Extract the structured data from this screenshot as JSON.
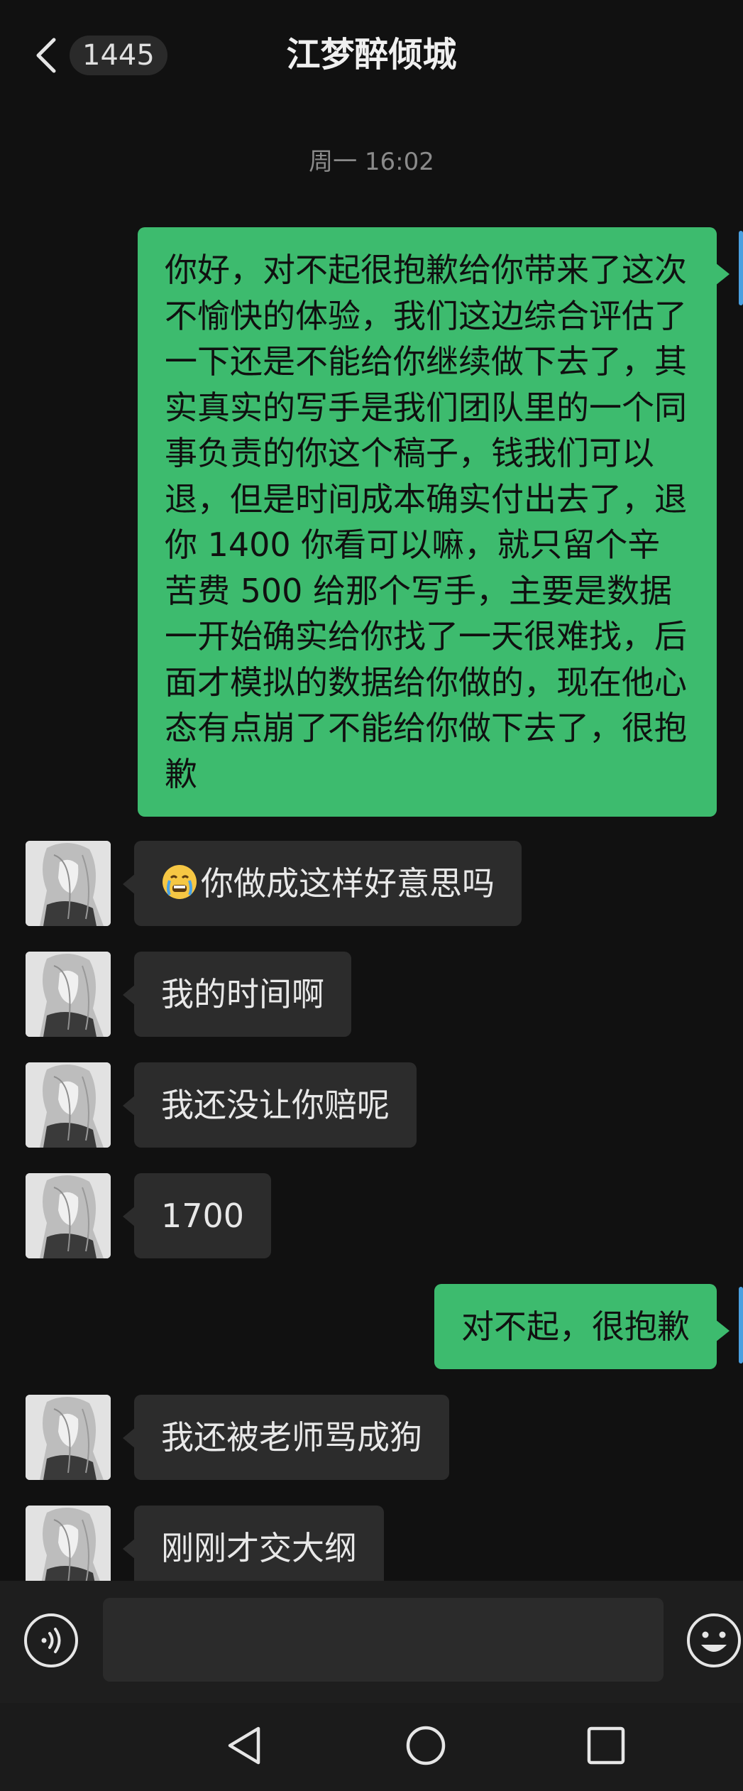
{
  "header": {
    "back_icon": "chevron-left-icon",
    "unread_count": "1445",
    "title": "江梦醉倾城"
  },
  "timestamp": "周一 16:02",
  "messages": [
    {
      "side": "out",
      "text": "你好，对不起很抱歉给你带来了这次不愉快的体验，我们这边综合评估了一下还是不能给你继续做下去了，其实真实的写手是我们团队里的一个同事负责的你这个稿子，钱我们可以退，但是时间成本确实付出去了，退你 1400 你看可以嘛，就只留个辛苦费 500 给那个写手，主要是数据一开始确实给你找了一天很难找，后面才模拟的数据给你做的，现在他心态有点崩了不能给你做下去了，很抱歉"
    },
    {
      "side": "in",
      "emoji": "crying-face-emoji",
      "text": "你做成这样好意思吗"
    },
    {
      "side": "in",
      "text": "我的时间啊"
    },
    {
      "side": "in",
      "text": "我还没让你赔呢"
    },
    {
      "side": "in",
      "text": "1700"
    },
    {
      "side": "out",
      "text": "对不起，很抱歉"
    },
    {
      "side": "in",
      "text": "我还被老师骂成狗"
    },
    {
      "side": "in",
      "text": "刚刚才交大纲"
    }
  ],
  "input_bar": {
    "voice_icon": "voice-icon",
    "input_value": "",
    "emoji_icon": "smiley-icon"
  },
  "nav_bar": {
    "back_icon": "triangle-back-icon",
    "home_icon": "circle-home-icon",
    "recents_icon": "square-recents-icon"
  },
  "colors": {
    "background": "#111111",
    "outgoing_bubble": "#3dbb6e",
    "incoming_bubble": "#2c2c2c"
  }
}
